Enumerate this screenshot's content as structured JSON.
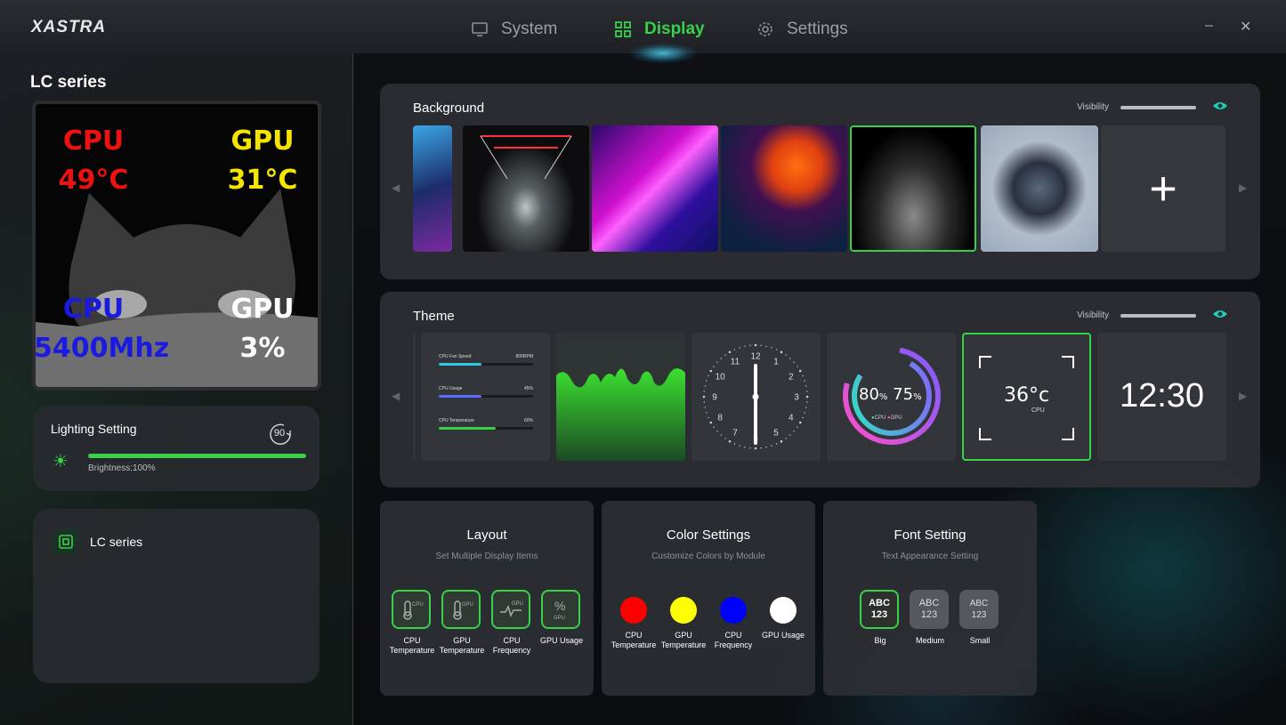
{
  "app": {
    "logo": "XASTRA",
    "minimize": "–",
    "close": "✕"
  },
  "nav": {
    "tabs": [
      {
        "label": "System",
        "icon": "monitor-icon"
      },
      {
        "label": "Display",
        "icon": "grid-icon"
      },
      {
        "label": "Settings",
        "icon": "gear-icon"
      }
    ],
    "active": "Display"
  },
  "colors": {
    "accent": "#39d04a",
    "teal": "#1fd0b8"
  },
  "left": {
    "title": "LC series",
    "preview": {
      "cpu_temp_label": "CPU",
      "cpu_temp": "49°C",
      "gpu_temp_label": "GPU",
      "gpu_temp": "31°C",
      "cpu_freq_label": "CPU",
      "cpu_freq": "5400Mhz",
      "gpu_usage_label": "GPU",
      "gpu_usage": "3%"
    },
    "lighting": {
      "title": "Lighting Setting",
      "rotation": "90",
      "brightness_label": "Brightness:100%",
      "brightness_value": 1.0
    },
    "devices": [
      {
        "name": "LC series"
      }
    ]
  },
  "background": {
    "title": "Background",
    "visibility_label": "Visibility",
    "add_label": "+"
  },
  "theme": {
    "title": "Theme",
    "visibility_label": "Visibility",
    "bars": [
      {
        "label": "CPU Fan Speed",
        "value": "800RPM",
        "fill": 0.45
      },
      {
        "label": "CPU Usage",
        "value": "45%",
        "fill": 0.45
      },
      {
        "label": "CPU Temperature",
        "value": "60%",
        "fill": 0.6
      }
    ],
    "ring": {
      "left": "80",
      "right": "75",
      "left_unit": "%",
      "right_unit": "%",
      "legend_cpu": "CPU",
      "legend_gpu": "GPU"
    },
    "temp": {
      "value": "36°c",
      "label": "CPU"
    },
    "clock_digital": "12:30",
    "clock_numbers": [
      "12",
      "1",
      "2",
      "3",
      "4",
      "5",
      "6",
      "7",
      "8",
      "9",
      "10",
      "11"
    ]
  },
  "layout": {
    "title": "Layout",
    "subtitle": "Set Multiple Display Items",
    "items": [
      {
        "label": "CPU Temperature",
        "icon": "cpu-thermometer-icon"
      },
      {
        "label": "GPU Temperature",
        "icon": "gpu-thermometer-icon"
      },
      {
        "label": "CPU Frequency",
        "icon": "cpu-frequency-icon"
      },
      {
        "label": "GPU Usage",
        "icon": "gpu-usage-icon"
      }
    ]
  },
  "color_settings": {
    "title": "Color Settings",
    "subtitle": "Customize Colors by Module",
    "items": [
      {
        "label": "CPU Temperature",
        "color": "#ff0000"
      },
      {
        "label": "GPU Temperature",
        "color": "#ffff00"
      },
      {
        "label": "CPU Frequency",
        "color": "#0000ff"
      },
      {
        "label": "GPU Usage",
        "color": "#ffffff"
      }
    ]
  },
  "font_setting": {
    "title": "Font Setting",
    "subtitle": "Text Appearance Setting",
    "items": [
      {
        "label": "Big",
        "line1": "ABC",
        "line2": "123"
      },
      {
        "label": "Medium",
        "line1": "ABC",
        "line2": "123"
      },
      {
        "label": "Small",
        "line1": "ABC",
        "line2": "123"
      }
    ],
    "selected": "Big"
  }
}
